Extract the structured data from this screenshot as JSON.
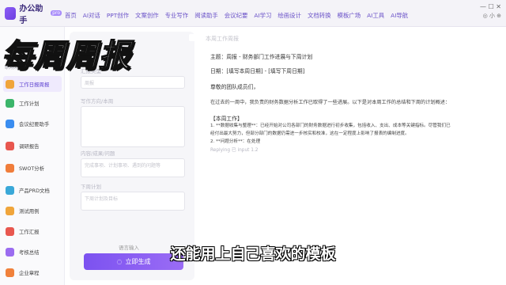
{
  "app": {
    "name": "办公助手",
    "badge": "pro"
  },
  "nav": [
    "首页",
    "AI对话",
    "PPT创作",
    "文案创作",
    "专业写作",
    "阅读助手",
    "会议纪要",
    "AI学习",
    "绘画设计",
    "文档转换",
    "模板广场",
    "AI工具",
    "AI导航"
  ],
  "window": {
    "controls": "— ☐ ✕",
    "tray": "◎ 小 ⊕"
  },
  "sidebar": {
    "section": "职场场景",
    "items": [
      {
        "label": "工作日报周报",
        "color": "#f0a53b",
        "active": true
      },
      {
        "label": "工作计划",
        "color": "#3bb56a",
        "active": false
      },
      {
        "label": "会议纪要助手",
        "color": "#3a8df0",
        "active": false
      },
      {
        "label": "调研报告",
        "color": "#e8574f",
        "active": false
      },
      {
        "label": "SWOT分析",
        "color": "#f07d3b",
        "active": false
      },
      {
        "label": "产品PRD文档",
        "color": "#3aa8d8",
        "active": false
      },
      {
        "label": "测试用例",
        "color": "#f0a53b",
        "active": false
      },
      {
        "label": "工作汇报",
        "color": "#e8574f",
        "active": false
      },
      {
        "label": "考核总结",
        "color": "#9b6cf0",
        "active": false
      },
      {
        "label": "企业章程",
        "color": "#f0813b",
        "active": false
      }
    ]
  },
  "form": {
    "fields": [
      {
        "label": "汇报类型",
        "placeholder": "周报"
      },
      {
        "label": "写作方向/本周",
        "placeholder": ""
      },
      {
        "label": "内容/成果/问题",
        "placeholder": "完成事项、计划事项、遇到的问题等"
      },
      {
        "label": "下周计划",
        "placeholder": "下周计划及目标"
      }
    ],
    "option_label": "语言输入",
    "generate_label": "立即生成"
  },
  "document": {
    "header": "本周工作周报",
    "lines": [
      "主题：周报 - 财务部门工作进展与下周计划",
      "日期：[填写本周日期] - [填写下周日期]",
      "尊敬的团队成员们，",
      "在过去的一周中，我负责的财务数据分析工作已取得了一些进展。以下是对本周工作的总结和下周的计划概述：",
      "【本周工作】",
      "1. **数据收集与整理**：已经开始对公司各部门的财务数据进行初步收集，包括收入、支出、成本等关键指标。尽管我们已",
      "经付出最大努力，但部分部门的数据仍需进一步核实和校准，这在一定程度上影响了报表的编制进度。",
      "2. **问题分析**：在处理"
    ],
    "meta": "Replying 已 input 1.2"
  },
  "overlay": {
    "title": "每周周报",
    "subtitle": "还能用上自己喜欢的模板"
  }
}
